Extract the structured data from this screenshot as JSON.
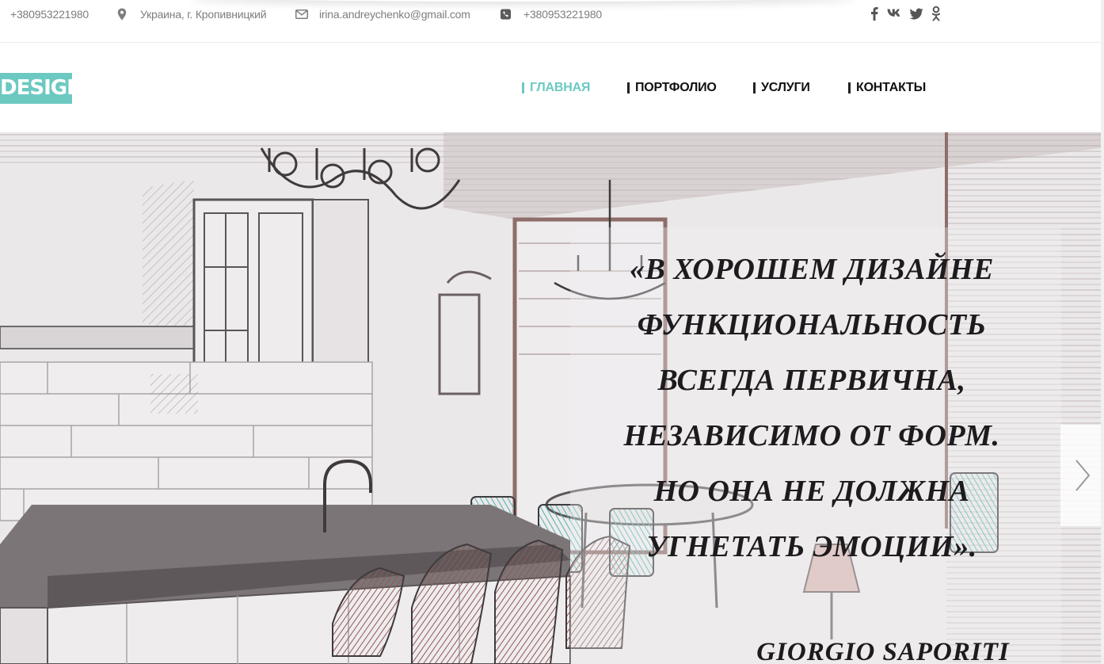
{
  "topbar": {
    "phone_primary": "+380953221980",
    "location": "Украина, г. Кропивницкий",
    "email": "irina.andreychenko@gmail.com",
    "phone_secondary": "+380953221980",
    "icons": [
      "map-marker-icon",
      "envelope-icon",
      "phone-square-icon"
    ],
    "social": [
      "facebook-icon",
      "vk-icon",
      "twitter-icon",
      "odnoklassniki-icon"
    ]
  },
  "header": {
    "logo": "DESIGN",
    "nav": [
      {
        "label": "ГЛАВНАЯ",
        "active": true
      },
      {
        "label": "ПОРТФОЛИО",
        "active": false
      },
      {
        "label": "УСЛУГИ",
        "active": false
      },
      {
        "label": "КОНТАКТЫ",
        "active": false
      }
    ]
  },
  "hero": {
    "quote_lines": [
      "«В ХОРОШЕМ ДИЗАЙНЕ",
      "ФУНКЦИОНАЛЬНОСТЬ",
      "ВСЕГДА ПЕРВИЧНА,",
      "НЕЗАВИСИМО ОТ ФОРМ.",
      "НО ОНА НЕ ДОЛЖНА",
      "УГНЕТАТЬ ЭМОЦИИ»."
    ],
    "author": "GIORGIO SAPORITI",
    "next_icon": "chevron-right-icon"
  },
  "colors": {
    "accent": "#6cc9c2",
    "text_dark": "#111111",
    "text_muted": "#7d7d7d"
  }
}
